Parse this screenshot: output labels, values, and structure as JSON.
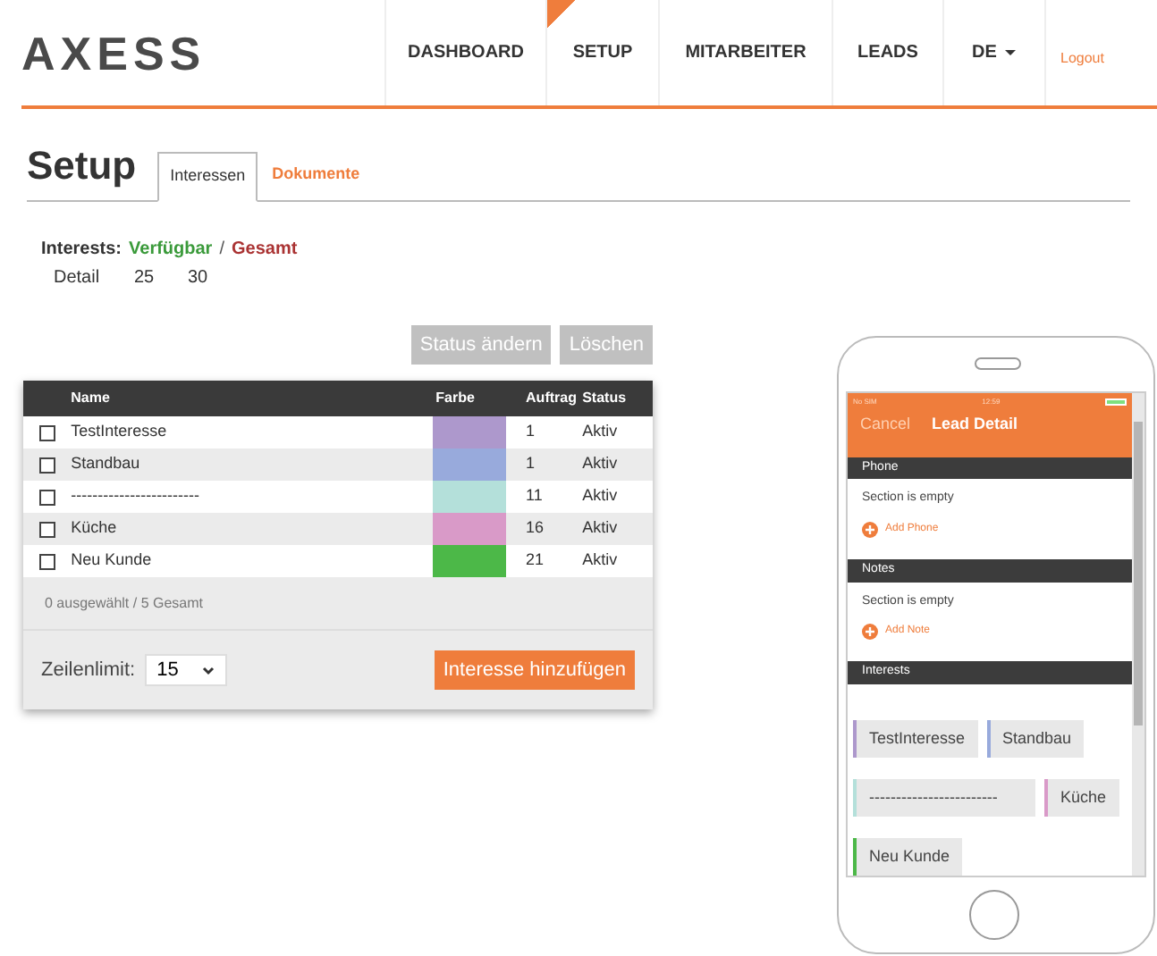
{
  "nav": {
    "logo": "AXESS",
    "items": [
      {
        "label": "DASHBOARD",
        "selected": false
      },
      {
        "label": "SETUP",
        "selected": true
      },
      {
        "label": "MITARBEITER",
        "selected": false
      },
      {
        "label": "LEADS",
        "selected": false
      }
    ],
    "language": "DE",
    "logout": "Logout"
  },
  "page": {
    "title": "Setup",
    "tabs": [
      {
        "label": "Interessen",
        "selected": true
      },
      {
        "label": "Dokumente",
        "selected": false
      }
    ]
  },
  "summary": {
    "label": "Interests:",
    "available_label": "Verfügbar",
    "separator": "/",
    "total_label": "Gesamt",
    "row_label": "Detail",
    "available": "25",
    "total": "30"
  },
  "actions": [
    {
      "label": "Status ändern",
      "disabled": true
    },
    {
      "label": "Löschen",
      "disabled": true
    }
  ],
  "table": {
    "columns": [
      "Name",
      "Farbe",
      "Auftrag",
      "Status"
    ],
    "rows": [
      {
        "name": "TestInteresse",
        "color": "#ad98cc",
        "order": "1",
        "status": "Aktiv",
        "checked": false
      },
      {
        "name": "Standbau",
        "color": "#98aadc",
        "order": "1",
        "status": "Aktiv",
        "checked": false
      },
      {
        "name": "------------------------",
        "color": "#b4e0da",
        "order": "11",
        "status": "Aktiv",
        "checked": false
      },
      {
        "name": "Küche",
        "color": "#d99ac8",
        "order": "16",
        "status": "Aktiv",
        "checked": false
      },
      {
        "name": "Neu Kunde",
        "color": "#4cb848",
        "order": "21",
        "status": "Aktiv",
        "checked": false
      }
    ],
    "selection_info": "0 ausgewählt / 5 Gesamt",
    "limit_label": "Zeilenlimit:",
    "limit_value": "15",
    "add_button": "Interesse hinzufügen"
  },
  "phone": {
    "carrier": "No SIM",
    "time": "12:59",
    "cancel": "Cancel",
    "title": "Lead Detail",
    "sections": [
      {
        "kind": "empty",
        "header": "Phone",
        "message": "Section is empty",
        "action": "Add Phone"
      },
      {
        "kind": "empty",
        "header": "Notes",
        "message": "Section is empty",
        "action": "Add Note"
      },
      {
        "kind": "tags",
        "header": "Interests",
        "tags": [
          {
            "label": "TestInteresse",
            "color": "#ad98cc"
          },
          {
            "label": "Standbau",
            "color": "#98aadc"
          },
          {
            "label": "------------------------",
            "color": "#b4e0da"
          },
          {
            "label": "Küche",
            "color": "#d99ac8"
          },
          {
            "label": "Neu Kunde",
            "color": "#4cb848"
          }
        ]
      }
    ]
  }
}
